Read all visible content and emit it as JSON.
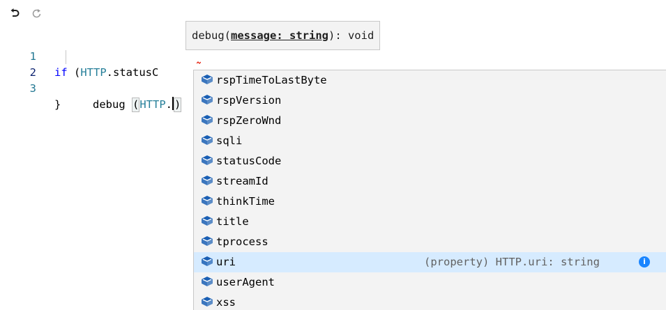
{
  "toolbar": {
    "undo_icon": "undo-icon",
    "redo_icon": "redo-icon"
  },
  "editor": {
    "lines": [
      {
        "number": "1",
        "tokens": [
          "if",
          " (",
          "HTTP",
          ".statusC"
        ]
      },
      {
        "number": "2",
        "tokens": [
          "debug ",
          "(",
          "HTTP",
          ".",
          ")"
        ]
      },
      {
        "number": "3",
        "tokens": [
          "}"
        ]
      }
    ]
  },
  "parameter_hint": {
    "prefix": "debug(",
    "active_param": "message: string",
    "suffix": "): void"
  },
  "suggestions": {
    "icon": "property-icon",
    "accent_color": "#1a5fb4",
    "selected_bg": "#d6ebff",
    "items": [
      {
        "label": "rspTimeToLastByte"
      },
      {
        "label": "rspVersion"
      },
      {
        "label": "rspZeroWnd"
      },
      {
        "label": "sqli"
      },
      {
        "label": "statusCode"
      },
      {
        "label": "streamId"
      },
      {
        "label": "thinkTime"
      },
      {
        "label": "title"
      },
      {
        "label": "tprocess"
      },
      {
        "label": "uri",
        "detail": "(property) HTTP.uri: string",
        "info": "i",
        "selected": true
      },
      {
        "label": "userAgent"
      },
      {
        "label": "xss"
      }
    ]
  }
}
